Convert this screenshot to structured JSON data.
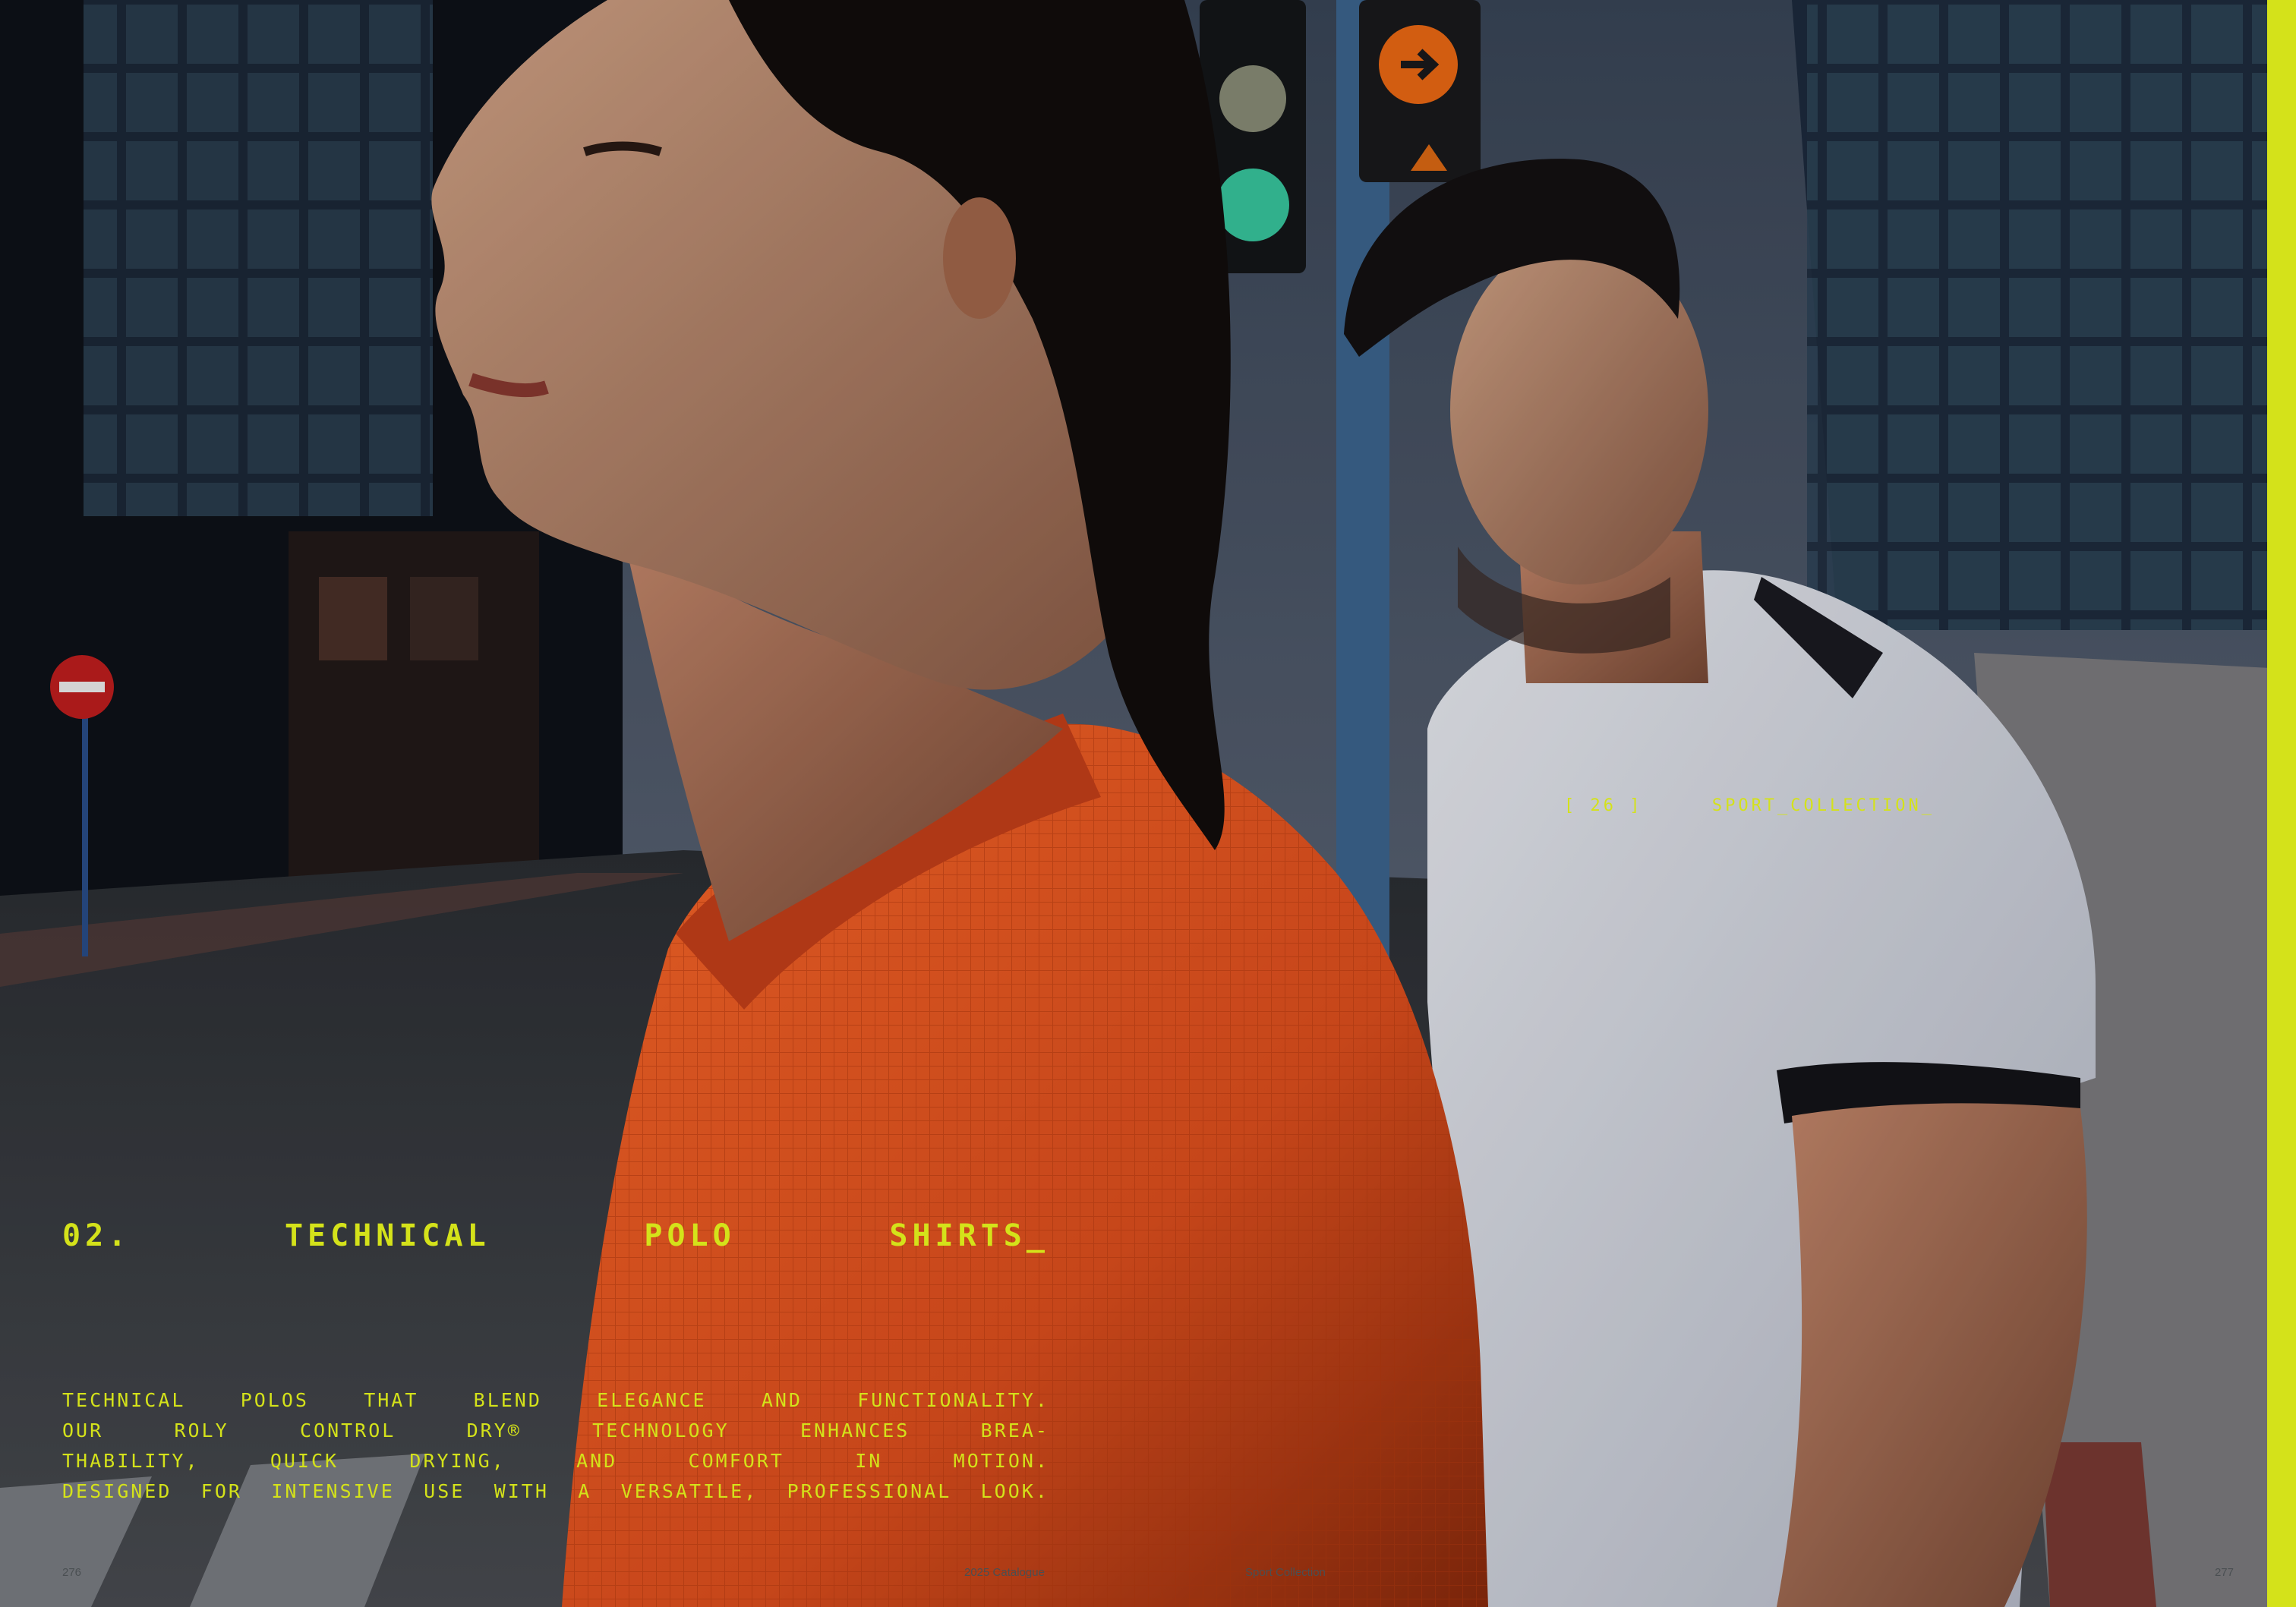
{
  "page": {
    "title_parts": [
      "02.",
      "TECHNICAL",
      "POLO",
      "SHIRTS_"
    ],
    "section_tag": {
      "number": "[ 26 ]",
      "name": "SPORT_COLLECTION_"
    },
    "body_lines": [
      [
        "TECHNICAL",
        "POLOS",
        "THAT",
        "BLEND",
        "ELEGANCE",
        "AND",
        "FUNCTIONALITY."
      ],
      [
        "OUR",
        "ROLY",
        "CONTROL",
        "DRY®",
        "TECHNOLOGY",
        "ENHANCES",
        "BREA-"
      ],
      [
        "THABILITY,",
        "QUICK",
        "DRYING,",
        "AND",
        "COMFORT",
        "IN",
        "MOTION."
      ],
      [
        "DESIGNED",
        "FOR",
        "INTENSIVE",
        "USE",
        "WITH",
        "A",
        "VERSATILE,",
        "PROFESSIONAL",
        "LOOK."
      ]
    ],
    "footer": {
      "page_left": "276",
      "center_left": "2025 Catalogue",
      "center_right": "Sport Collection",
      "page_right": "277"
    }
  },
  "colors": {
    "accent": "#d4e21a",
    "background": "#0c0f14",
    "orange_polo": "#e2501e",
    "white_polo": "#dfe3ec"
  },
  "scene_description_icons": [
    "traffic-light-icon",
    "no-entry-sign-icon"
  ]
}
